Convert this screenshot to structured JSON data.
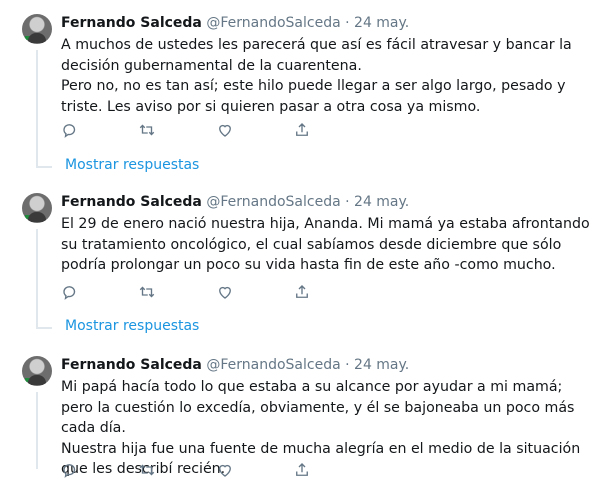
{
  "tweets": [
    {
      "author_name": "Fernando Salceda",
      "handle": "@FernandoSalceda",
      "separator": "·",
      "date": "24 may.",
      "paragraphs": [
        "A muchos de ustedes les parecerá que así es fácil atravesar y bancar la decisión gubernamental de la cuarentena.",
        "Pero no, no es tan así; este hilo puede llegar a ser algo largo, pesado y triste. Les aviso por si quieren pasar a otra cosa ya mismo."
      ]
    },
    {
      "author_name": "Fernando Salceda",
      "handle": "@FernandoSalceda",
      "separator": "·",
      "date": "24 may.",
      "paragraphs": [
        "El 29 de enero nació nuestra hija, Ananda. Mi mamá ya estaba afrontando su tratamiento oncológico, el cual sabíamos desde diciembre que sólo podría prolongar un poco su vida hasta fin de este año -como mucho."
      ]
    },
    {
      "author_name": "Fernando Salceda",
      "handle": "@FernandoSalceda",
      "separator": "·",
      "date": "24 may.",
      "paragraphs": [
        "Mi papá hacía todo lo que estaba a su alcance por ayudar a mi mamá; pero la cuestión lo excedía, obviamente, y él se bajoneaba un poco más cada día.",
        "Nuestra hija fue una fuente de mucha alegría en el medio de la situación que les describí recién."
      ]
    }
  ],
  "show_replies_label": "Mostrar respuestas",
  "colors": {
    "link": "#1b95e0",
    "muted": "#657786",
    "text": "#14171a",
    "line": "#e1e8ed"
  },
  "icons": [
    "reply-icon",
    "retweet-icon",
    "like-icon",
    "share-icon"
  ]
}
